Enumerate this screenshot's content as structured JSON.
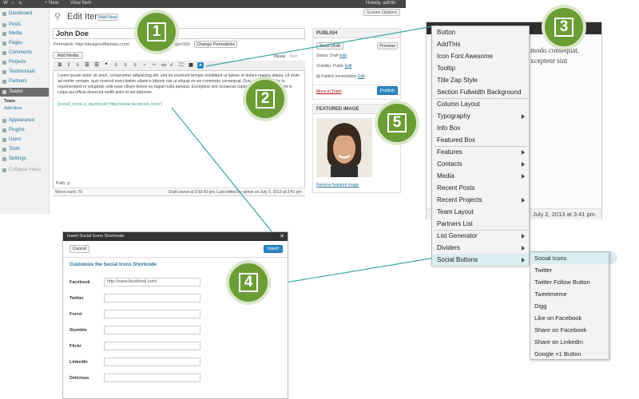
{
  "admin_bar": {
    "new": "+ New",
    "view_item": "View Item",
    "howdy": "Howdy, admin"
  },
  "side_menu": {
    "items": [
      "Dashboard",
      "Posts",
      "Media",
      "Pages",
      "Comments",
      "Projects",
      "Testimonials",
      "Partners",
      "Teams",
      "Appearance",
      "Plugins",
      "Users",
      "Tools",
      "Settings",
      "Collapse menu"
    ],
    "teams_submenu": [
      "Team",
      "Add New"
    ]
  },
  "editor": {
    "page_title": "Edit Item",
    "add_new": "Add New",
    "screen_options": "Screen Options",
    "post_title": "John Doe",
    "permalink_label": "Permalink: http://designedthemes.com/",
    "permalink_suffix": "...tem&p=165",
    "change_permalinks": "Change Permalinks",
    "add_media": "Add Media",
    "tab_visual": "Visual",
    "tab_text": "Text",
    "content": "Lorem ipsum dolor sit amet, consectetur adipisicing elit, sed do eiusmod tempor incididunt ut labore et dolore magna aliqua. Ut enim ad minim veniam, quis nostrud exercitation ullamco laboris nisi ut aliquip ex ea commodo consequat. Duis aute irure dolor in reprehenderit in voluptate velit esse cillum dolore eu fugiat nulla pariatur. Excepteur sint occaecat cupidatat non proident, sunt in culpa qui officia deserunt mollit anim id est laborum.",
    "shortcode": "[social_icons p_facebook='http://www.facebook.com/']",
    "path": "Path: p",
    "word_count": "Word count: 70",
    "draft_saved": "Draft saved at 3:50:43 pm. Last edited by admin on July 2, 2013 at 3:41 pm"
  },
  "publish_box": {
    "title": "PUBLISH",
    "save_draft": "Save Draft",
    "preview": "Preview",
    "status": "Status: Draft",
    "visibility": "Visibility: Public",
    "publish_immediately": "Publish immediately",
    "edit": "Edit",
    "move_to_trash": "Move to Trash",
    "publish": "Publish"
  },
  "featured_box": {
    "title": "FEATURED IMAGE",
    "remove": "Remove featured image"
  },
  "dropdown": {
    "items": [
      {
        "label": "Button",
        "arrow": false
      },
      {
        "label": "AddThis",
        "arrow": false
      },
      {
        "label": "Icon Font Awesome",
        "arrow": false
      },
      {
        "label": "Tooltip",
        "arrow": false
      },
      {
        "label": "Title Zap Style",
        "arrow": false
      },
      {
        "label": "Section Fullwidth Background",
        "arrow": false
      },
      {
        "label": "Column Layout",
        "arrow": false
      },
      {
        "label": "Typography",
        "arrow": true
      },
      {
        "label": "Info Box",
        "arrow": false
      },
      {
        "label": "Featured Box",
        "arrow": false
      },
      {
        "label": "Features",
        "arrow": true
      },
      {
        "label": "Contacts",
        "arrow": true
      },
      {
        "label": "Media",
        "arrow": true
      },
      {
        "label": "Recent Posts",
        "arrow": false
      },
      {
        "label": "Recent Projects",
        "arrow": true
      },
      {
        "label": "Team Layout",
        "arrow": false
      },
      {
        "label": "Partners List",
        "arrow": false
      },
      {
        "label": "List Generator",
        "arrow": true
      },
      {
        "label": "Dividers",
        "arrow": true
      },
      {
        "label": "Social Buttons",
        "arrow": true
      }
    ],
    "social_submenu": [
      "Social Icons",
      "Twitter",
      "Twitter Follow Button",
      "Tweetmeme",
      "Digg",
      "Like on Facebook",
      "Share on Facebook",
      "Share on LinkedIn",
      "Google +1 Button"
    ],
    "bg_text_1": "modo consequat.",
    "bg_text_2": "xcepteur sint",
    "bg_date": "July 2, 2013 at 3:41 pm"
  },
  "modal": {
    "title": "Insert Social Icons Shortcode",
    "cancel": "Cancel",
    "insert": "Insert",
    "heading": "Customize the Social Icons Shortcode",
    "fields": [
      {
        "label": "Facebook",
        "value": "http://www.facebook.com/"
      },
      {
        "label": "Twitter",
        "value": ""
      },
      {
        "label": "Forrst",
        "value": ""
      },
      {
        "label": "Stumble",
        "value": ""
      },
      {
        "label": "Flickr",
        "value": ""
      },
      {
        "label": "LinkedIn",
        "value": ""
      },
      {
        "label": "Delicious",
        "value": ""
      }
    ]
  },
  "badges": [
    "1",
    "2",
    "3",
    "4",
    "5"
  ],
  "colors": {
    "badge_green": "#6b9d35",
    "connector_teal": "#3ba5a0",
    "wp_link": "#21759b",
    "publish_blue": "#2b88c3"
  }
}
